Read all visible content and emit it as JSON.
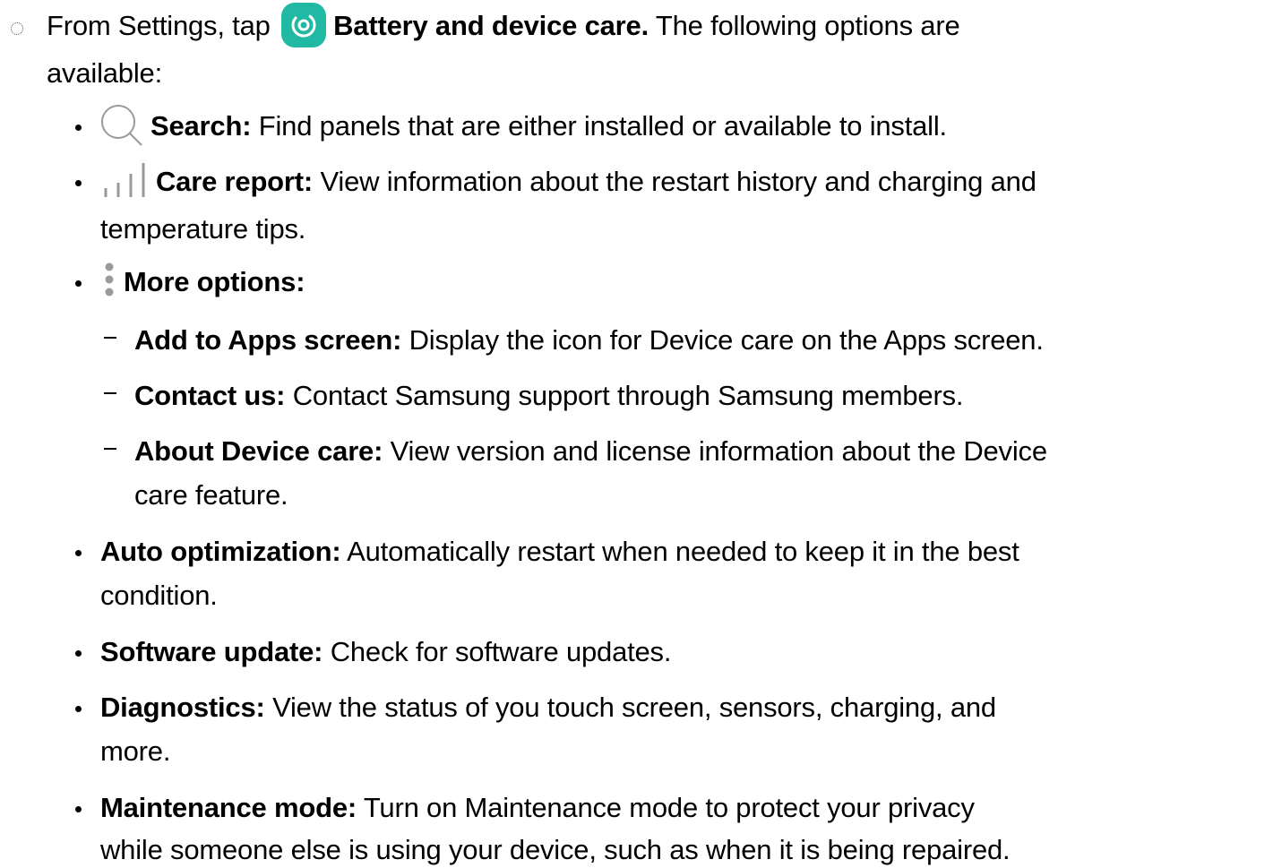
{
  "intro": {
    "from_settings": "From Settings, tap",
    "app_name": "Battery and device care.",
    "following": "The following options are",
    "available": "available:"
  },
  "items": {
    "search": {
      "label": "Search:",
      "text": "Find panels that are either installed or available to install."
    },
    "care_report": {
      "label": "Care report:",
      "text": "View information about the restart history and charging and",
      "text_cont": "temperature tips."
    },
    "more_options": {
      "label": "More options:"
    },
    "add_to_apps": {
      "label": "Add to Apps screen:",
      "text": "Display the icon for Device care on the Apps screen."
    },
    "contact_us": {
      "label": "Contact us:",
      "text": "Contact Samsung support through Samsung members."
    },
    "about": {
      "label": "About Device care:",
      "text": "View version and license information about the Device",
      "text_cont": "care feature."
    },
    "auto_opt": {
      "label": "Auto optimization:",
      "text": "Automatically restart when needed to keep it in the best",
      "text_cont": "condition."
    },
    "software": {
      "label": "Software update:",
      "text": "Check for software updates."
    },
    "diagnostics": {
      "label": "Diagnostics:",
      "text": "View the status of you touch screen, sensors, charging, and",
      "text_cont": "more."
    },
    "maintenance": {
      "label": "Maintenance mode:",
      "text": "Turn on Maintenance mode to protect your privacy",
      "text_cont": "while someone else is using your device, such as when it is being repaired."
    }
  },
  "icons": {
    "app_icon": "device-care-icon",
    "search_icon": "search-icon",
    "care_report_icon": "bar-chart-icon",
    "more_options_icon": "vertical-dots-icon"
  },
  "colors": {
    "app_icon_bg": "#21b9a3",
    "text": "#000000",
    "icon_gray": "#9a9a9a"
  }
}
